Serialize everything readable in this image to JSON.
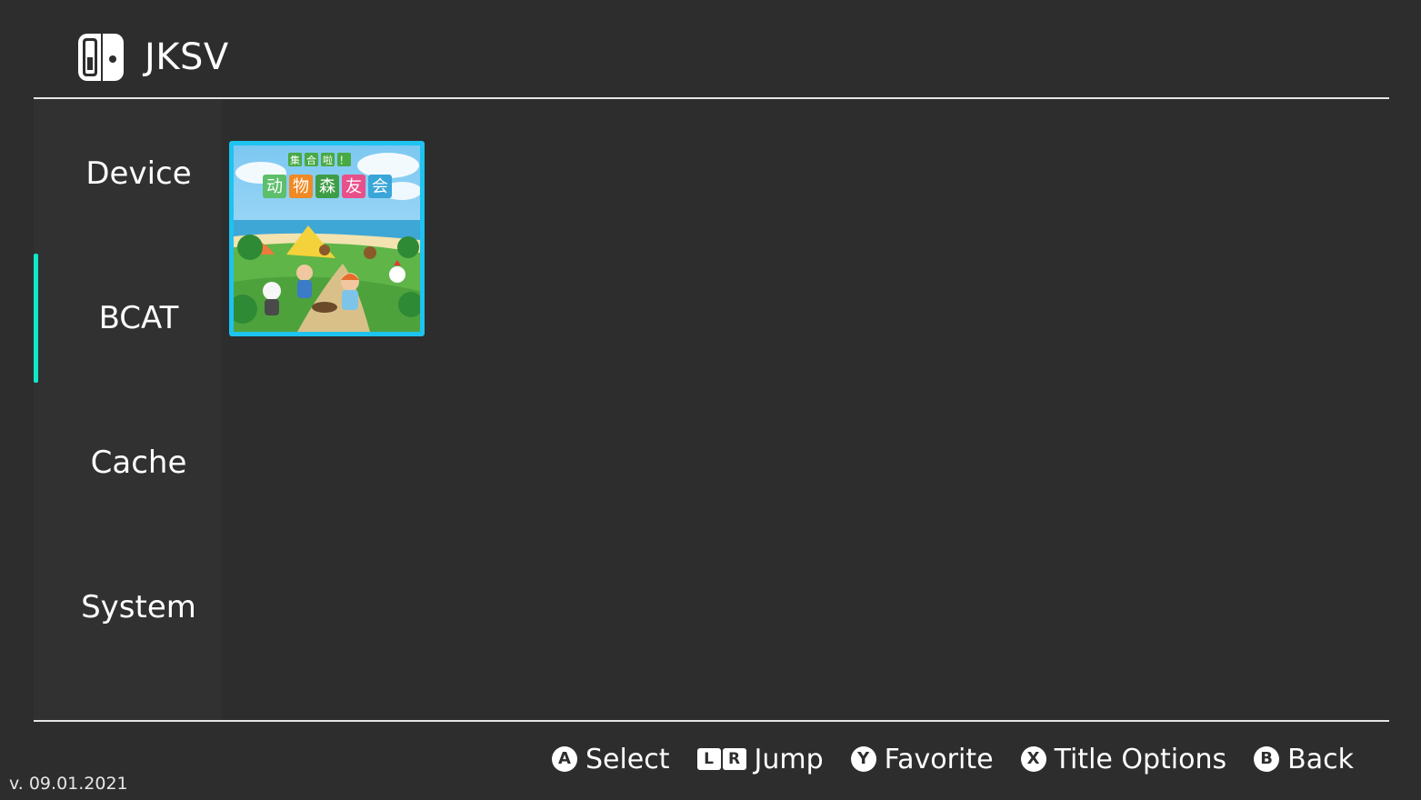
{
  "header": {
    "title": "JKSV",
    "logo_icon": "switch-console-icon"
  },
  "sidebar": {
    "items": [
      {
        "label": "Device",
        "selected": false
      },
      {
        "label": "BCAT",
        "selected": true
      },
      {
        "label": "Cache",
        "selected": false
      },
      {
        "label": "System",
        "selected": false
      }
    ],
    "accent_color": "#10e6c8"
  },
  "content": {
    "titles": [
      {
        "name_art_lines": [
          "集合啦！",
          "动物森友会"
        ],
        "selected": true,
        "selection_color": "#1ec3ef"
      }
    ]
  },
  "footer": {
    "version": "v. 09.01.2021",
    "hints": [
      {
        "button": "A",
        "label": "Select"
      },
      {
        "button_left": "L",
        "button_right": "R",
        "label": "Jump"
      },
      {
        "button": "Y",
        "label": "Favorite"
      },
      {
        "button": "X",
        "label": "Title Options"
      },
      {
        "button": "B",
        "label": "Back"
      }
    ]
  },
  "colors": {
    "background": "#2d2d2d",
    "sidebar": "#313131",
    "divider": "#e6e6e6",
    "text": "#ffffff"
  }
}
